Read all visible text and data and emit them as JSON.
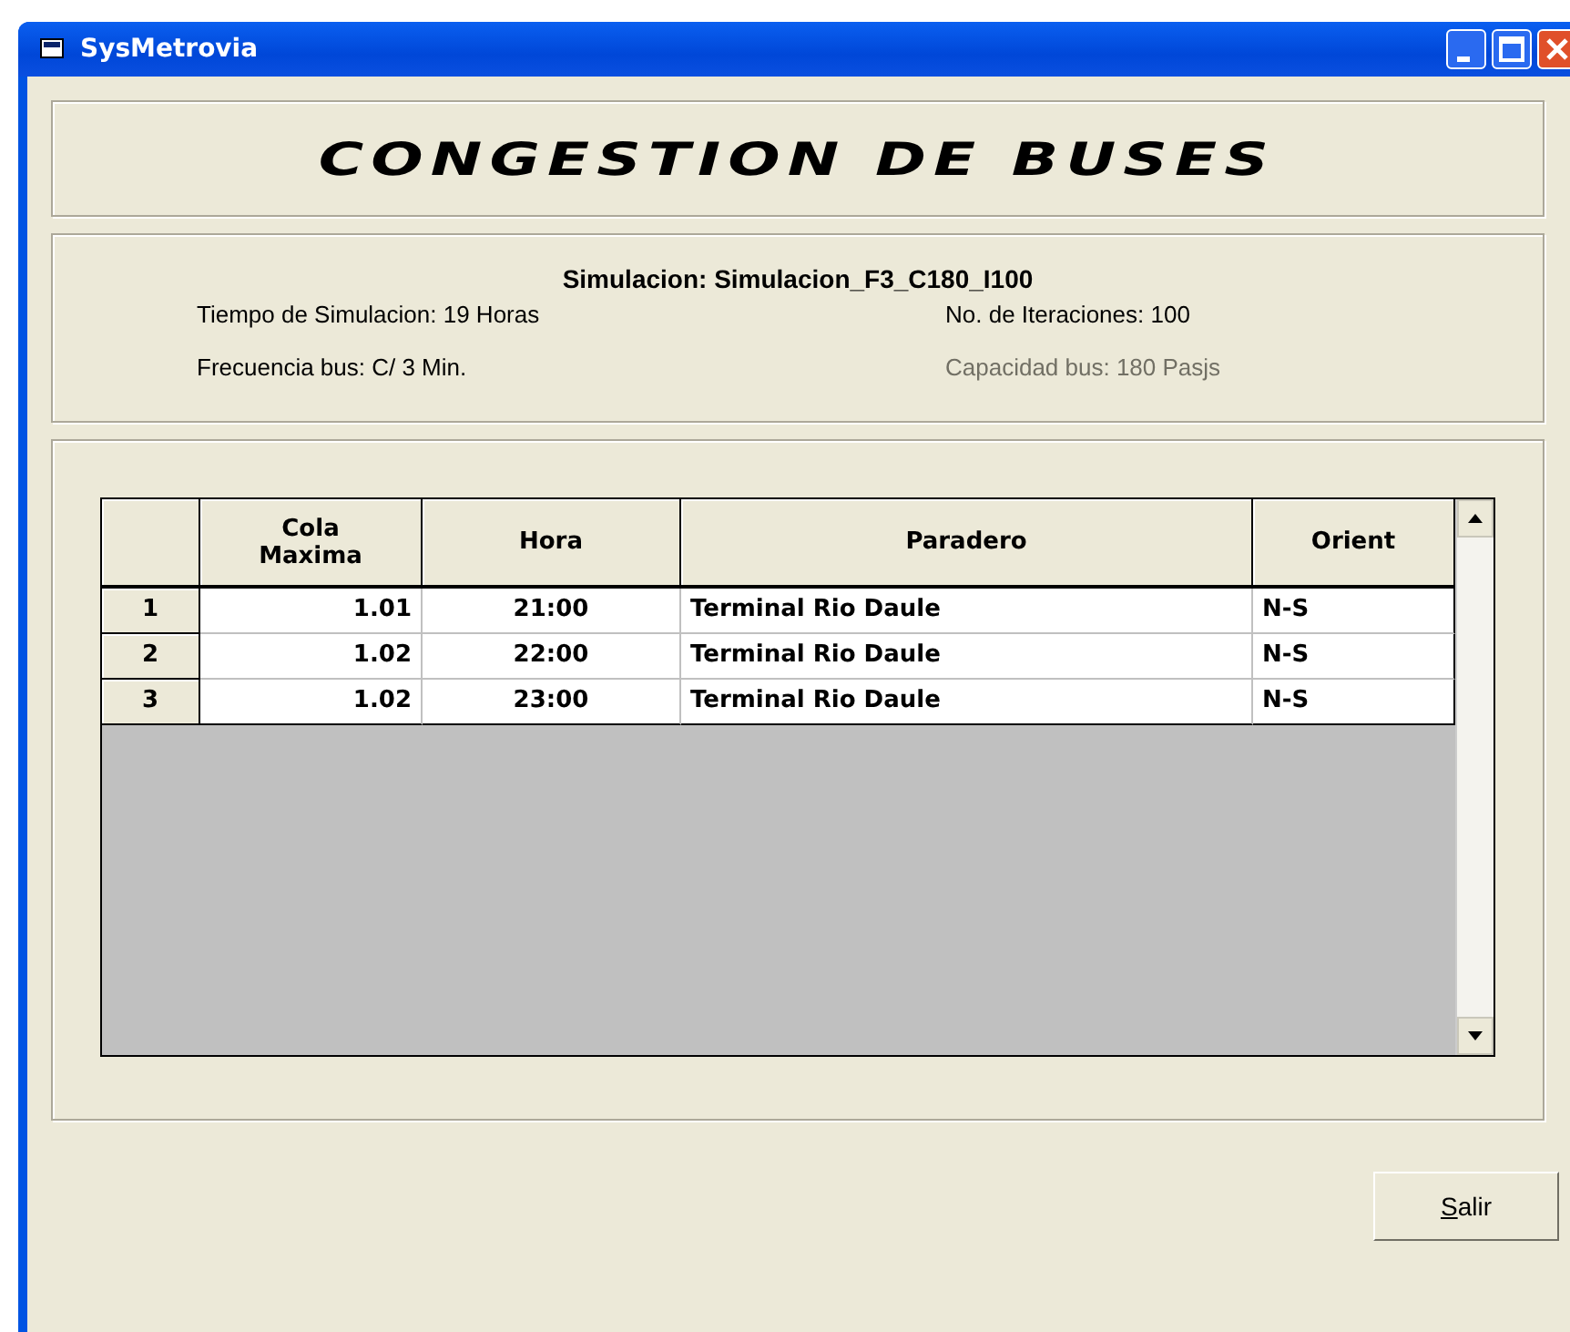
{
  "window": {
    "title": "SysMetrovia"
  },
  "heading": "CONGESTION DE BUSES",
  "summary": {
    "title": "Simulacion: Simulacion_F3_C180_I100",
    "fields": [
      {
        "text": "Tiempo de Simulacion: 19 Horas",
        "disabled": false
      },
      {
        "text": "No. de Iteraciones: 100",
        "disabled": false
      },
      {
        "text": "Frecuencia bus: C/ 3 Min.",
        "disabled": false
      },
      {
        "text": "Capacidad bus: 180 Pasjs",
        "disabled": true
      }
    ]
  },
  "table": {
    "columns": [
      "Cola Maxima",
      "Hora",
      "Paradero",
      "Orient"
    ],
    "rows": [
      {
        "index": "1",
        "cells": [
          "1.01",
          "21:00",
          "Terminal Rio Daule",
          "N-S"
        ]
      },
      {
        "index": "2",
        "cells": [
          "1.02",
          "22:00",
          "Terminal Rio Daule",
          "N-S"
        ]
      },
      {
        "index": "3",
        "cells": [
          "1.02",
          "23:00",
          "Terminal Rio Daule",
          "N-S"
        ]
      }
    ]
  },
  "buttons": [
    "Salir"
  ]
}
